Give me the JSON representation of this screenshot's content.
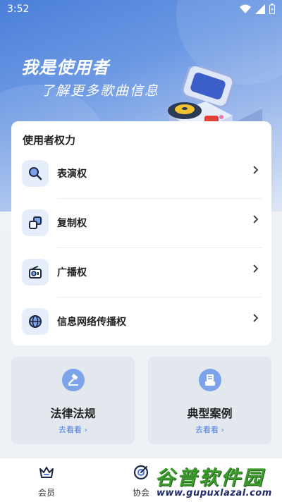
{
  "status_bar": {
    "time": "3:52"
  },
  "hero": {
    "title": "我是使用者",
    "subtitle": "了解更多歌曲信息"
  },
  "rights_card": {
    "title": "使用者权力",
    "items": [
      {
        "label": "表演权",
        "icon": "search-icon"
      },
      {
        "label": "复制权",
        "icon": "copy-icon"
      },
      {
        "label": "广播权",
        "icon": "radio-icon"
      },
      {
        "label": "信息网络传播权",
        "icon": "globe-icon"
      }
    ]
  },
  "tiles": [
    {
      "title": "法律法规",
      "link": "去看看 ›",
      "icon": "gavel-icon"
    },
    {
      "title": "典型案例",
      "link": "去看看 ›",
      "icon": "case-file-icon"
    }
  ],
  "tabbar": {
    "tabs": [
      {
        "label": "会员",
        "icon": "crown-icon"
      },
      {
        "label": "协会",
        "icon": "target-icon"
      }
    ]
  },
  "watermark": {
    "main": "谷普软件园",
    "url": "www.gupuxlazal.com"
  },
  "colors": {
    "accent": "#4f7ee0",
    "hero_top": "#4a7fd9",
    "watermark_green": "#3d9b2e"
  }
}
